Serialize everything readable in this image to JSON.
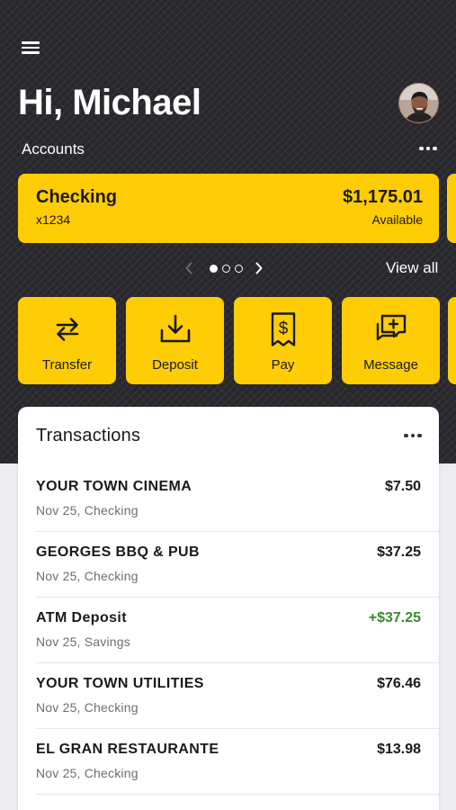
{
  "header": {
    "greeting": "Hi, Michael"
  },
  "accounts": {
    "label": "Accounts",
    "view_all": "View all",
    "card": {
      "name": "Checking",
      "number": "x1234",
      "balance": "$1,175.01",
      "balance_label": "Available"
    },
    "pager": {
      "total": 3,
      "active": 1
    }
  },
  "actions": [
    {
      "label": "Transfer",
      "icon": "transfer-icon"
    },
    {
      "label": "Deposit",
      "icon": "deposit-icon"
    },
    {
      "label": "Pay",
      "icon": "pay-icon"
    },
    {
      "label": "Message",
      "icon": "message-icon"
    }
  ],
  "transactions": {
    "title": "Transactions",
    "items": [
      {
        "name": "YOUR TOWN CINEMA",
        "meta": "Nov 25, Checking",
        "amount": "$7.50",
        "type": "debit"
      },
      {
        "name": "GEORGES BBQ & PUB",
        "meta": "Nov 25, Checking",
        "amount": "$37.25",
        "type": "debit"
      },
      {
        "name": "ATM Deposit",
        "meta": "Nov 25, Savings",
        "amount": "+$37.25",
        "type": "credit"
      },
      {
        "name": "YOUR TOWN UTILITIES",
        "meta": "Nov 25, Checking",
        "amount": "$76.46",
        "type": "debit"
      },
      {
        "name": "EL GRAN RESTAURANTE",
        "meta": "Nov 25, Checking",
        "amount": "$13.98",
        "type": "debit"
      }
    ]
  },
  "colors": {
    "accent": "#FFCD05",
    "hero_background": "#26262B",
    "credit": "#3A8A2E"
  }
}
